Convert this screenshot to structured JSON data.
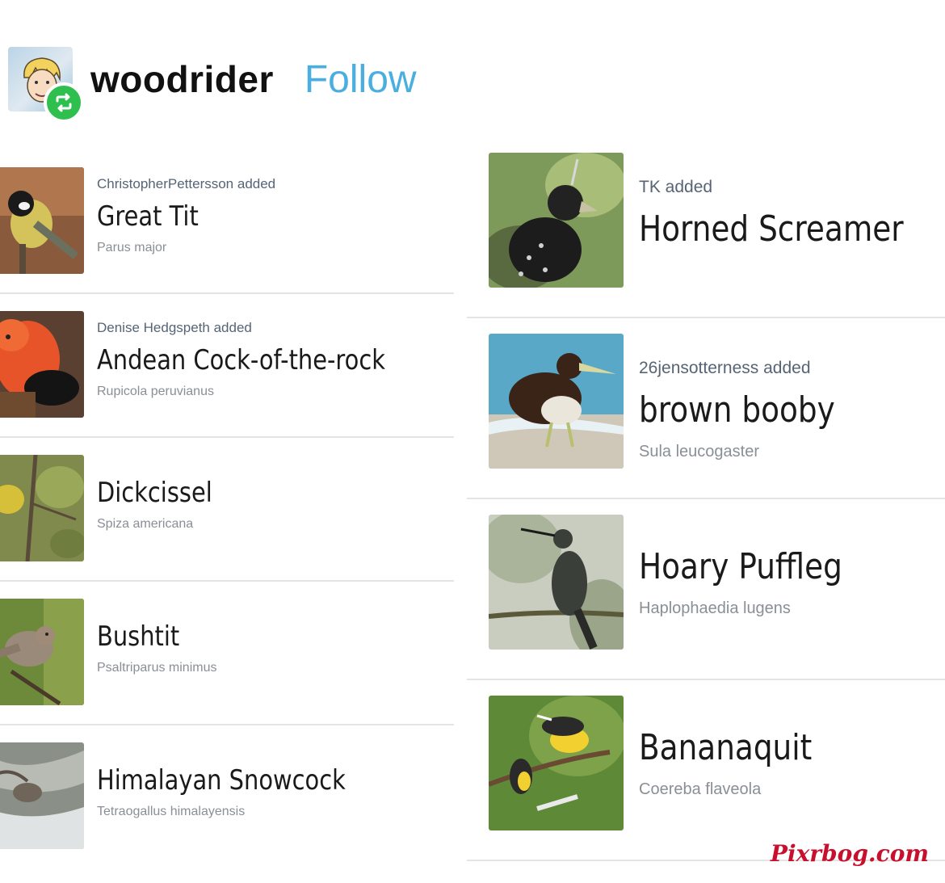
{
  "profile": {
    "username": "woodrider",
    "follow_label": "Follow",
    "badge_color": "#2fbf4f",
    "follow_color": "#4aaee0"
  },
  "left_items": [
    {
      "adder": "ChristopherPettersson added",
      "name": "Great Tit",
      "sci": "Parus major"
    },
    {
      "adder": "Denise Hedgspeth added",
      "name": "Andean Cock-of-the-rock",
      "sci": "Rupicola peruvianus"
    },
    {
      "adder": "",
      "name": "Dickcissel",
      "sci": "Spiza americana"
    },
    {
      "adder": "",
      "name": "Bushtit",
      "sci": "Psaltriparus minimus"
    },
    {
      "adder": "",
      "name": "Himalayan Snowcock",
      "sci": "Tetraogallus himalayensis"
    }
  ],
  "right_items": [
    {
      "adder": "TK added",
      "name": "Horned Screamer",
      "sci": ""
    },
    {
      "adder": "26jensotterness added",
      "name": "brown booby",
      "sci": "Sula leucogaster"
    },
    {
      "adder": "",
      "name": "Hoary Puffleg",
      "sci": "Haplophaedia lugens"
    },
    {
      "adder": "",
      "name": "Bananaquit",
      "sci": "Coereba flaveola"
    }
  ],
  "watermark": "Pixrbog.com"
}
